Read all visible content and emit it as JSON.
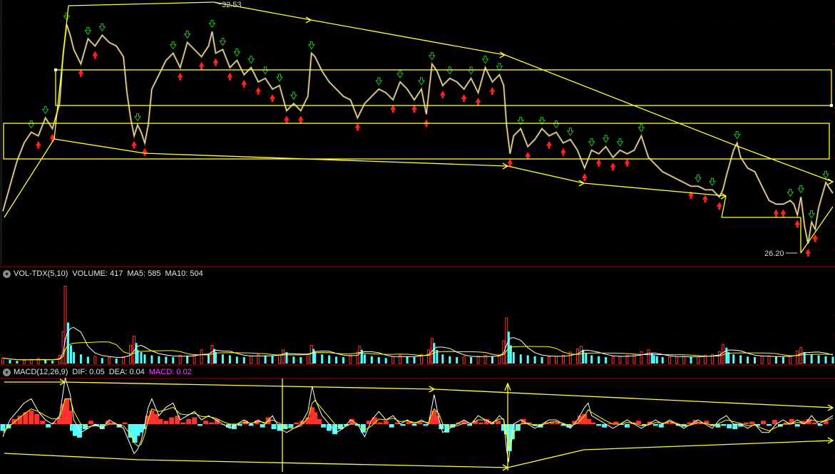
{
  "chart_data": {
    "type": "stock-chart",
    "price": {
      "type": "line",
      "high_label": "32.53",
      "low_label": "26.20",
      "ylim": [
        25.9,
        33.0
      ],
      "x": [
        0,
        10,
        20,
        30,
        40,
        50,
        60,
        70,
        80,
        85,
        90,
        95,
        100,
        110,
        120,
        130,
        140,
        150,
        160,
        170,
        175,
        180,
        185,
        190,
        195,
        200,
        205,
        210,
        220,
        230,
        240,
        250,
        260,
        270,
        280,
        290,
        295,
        300,
        310,
        320,
        330,
        340,
        350,
        360,
        370,
        380,
        390,
        400,
        410,
        420,
        430,
        435,
        440,
        450,
        460,
        470,
        480,
        490,
        500,
        505,
        510,
        520,
        530,
        540,
        550,
        560,
        570,
        580,
        590,
        597,
        605,
        612,
        620,
        630,
        640,
        650,
        660,
        670,
        680,
        690,
        700,
        706,
        710,
        715,
        720,
        730,
        740,
        750,
        760,
        770,
        780,
        790,
        800,
        810,
        820,
        830,
        840,
        850,
        860,
        870,
        880,
        890,
        900,
        910,
        920,
        930,
        940,
        950,
        960,
        970,
        980,
        990,
        1000,
        1010,
        1015,
        1020,
        1030,
        1035,
        1040,
        1050,
        1060,
        1070,
        1080,
        1090,
        1100,
        1110,
        1115,
        1120,
        1125,
        1130,
        1135,
        1140,
        1145,
        1150,
        1160,
        1170
      ],
      "y": [
        27.2,
        27.9,
        28.6,
        29.1,
        29.4,
        29.3,
        29.8,
        29.5,
        30.2,
        31.6,
        32.4,
        32.1,
        31.7,
        31.3,
        32.0,
        31.8,
        32.1,
        31.9,
        31.8,
        31.5,
        30.5,
        29.8,
        29.3,
        29.6,
        29.4,
        29.1,
        29.6,
        30.6,
        31.0,
        31.4,
        31.6,
        31.2,
        31.9,
        31.7,
        31.5,
        31.8,
        32.2,
        31.6,
        31.7,
        31.2,
        31.4,
        31.0,
        31.2,
        30.8,
        30.9,
        30.6,
        30.7,
        30.0,
        30.2,
        30.0,
        30.4,
        31.6,
        31.5,
        31.1,
        30.8,
        30.6,
        30.4,
        30.3,
        29.8,
        30.0,
        30.2,
        30.4,
        30.6,
        30.5,
        30.3,
        30.8,
        30.6,
        30.3,
        30.6,
        29.9,
        31.3,
        31.1,
        30.7,
        30.9,
        30.8,
        30.6,
        30.9,
        30.5,
        31.2,
        30.8,
        31.0,
        30.7,
        29.6,
        28.8,
        29.3,
        29.5,
        29.0,
        29.2,
        29.5,
        29.3,
        29.4,
        29.1,
        29.2,
        28.9,
        28.4,
        28.9,
        28.8,
        29.0,
        28.7,
        28.9,
        28.8,
        28.9,
        29.3,
        28.7,
        28.5,
        28.3,
        28.2,
        28.1,
        28.0,
        27.9,
        27.9,
        27.8,
        27.8,
        27.6,
        27.8,
        28.2,
        28.9,
        29.1,
        28.7,
        28.4,
        28.3,
        27.9,
        27.5,
        27.4,
        27.4,
        27.5,
        27.4,
        27.1,
        27.6,
        26.8,
        26.3,
        26.9,
        26.7,
        27.3,
        28.0,
        27.7,
        27.5,
        27.3
      ]
    },
    "volume": {
      "type": "bar",
      "title": "VOL-TDX(5,10)",
      "stats": [
        {
          "label": "VOLUME",
          "value": "417"
        },
        {
          "label": "MA5",
          "value": "585"
        },
        {
          "label": "MA10",
          "value": "504"
        }
      ],
      "x": [
        0,
        10,
        20,
        30,
        40,
        50,
        60,
        70,
        80,
        85,
        88,
        92,
        96,
        100,
        110,
        120,
        130,
        140,
        150,
        160,
        170,
        180,
        185,
        188,
        190,
        195,
        200,
        210,
        220,
        230,
        240,
        250,
        260,
        270,
        280,
        290,
        295,
        298,
        300,
        310,
        320,
        330,
        340,
        350,
        360,
        370,
        380,
        390,
        395,
        400,
        410,
        420,
        430,
        435,
        438,
        440,
        450,
        460,
        470,
        480,
        490,
        500,
        503,
        506,
        510,
        520,
        530,
        540,
        550,
        560,
        570,
        580,
        590,
        600,
        605,
        608,
        612,
        620,
        630,
        640,
        650,
        660,
        670,
        680,
        690,
        700,
        706,
        710,
        713,
        716,
        720,
        730,
        740,
        750,
        760,
        770,
        780,
        790,
        800,
        810,
        815,
        818,
        822,
        830,
        840,
        850,
        860,
        870,
        880,
        890,
        900,
        910,
        915,
        918,
        922,
        930,
        940,
        950,
        960,
        970,
        980,
        990,
        1000,
        1010,
        1015,
        1020,
        1023,
        1030,
        1040,
        1050,
        1060,
        1070,
        1080,
        1090,
        1100,
        1110,
        1120,
        1125,
        1130,
        1140,
        1150,
        1160,
        1170
      ],
      "values": [
        120,
        80,
        60,
        70,
        90,
        110,
        80,
        60,
        180,
        700,
        1700,
        900,
        400,
        250,
        200,
        150,
        160,
        120,
        130,
        110,
        150,
        400,
        600,
        450,
        300,
        250,
        200,
        180,
        160,
        150,
        140,
        180,
        170,
        200,
        300,
        200,
        400,
        320,
        250,
        200,
        180,
        150,
        140,
        160,
        200,
        180,
        170,
        200,
        300,
        250,
        150,
        140,
        200,
        400,
        320,
        250,
        200,
        180,
        150,
        140,
        180,
        250,
        380,
        300,
        200,
        160,
        140,
        120,
        150,
        180,
        160,
        140,
        200,
        300,
        550,
        450,
        300,
        200,
        160,
        140,
        150,
        140,
        160,
        180,
        150,
        200,
        500,
        1000,
        700,
        400,
        250,
        200,
        180,
        160,
        140,
        150,
        160,
        180,
        250,
        320,
        380,
        300,
        220,
        180,
        160,
        140,
        150,
        160,
        180,
        200,
        260,
        300,
        220,
        180,
        160,
        140,
        140,
        150,
        160,
        140,
        150,
        180,
        200,
        260,
        420,
        350,
        250,
        200,
        180,
        150,
        140,
        160,
        170,
        150,
        140,
        160,
        280,
        350,
        250,
        200,
        180,
        160,
        150
      ]
    },
    "macd": {
      "type": "line+bar",
      "title": "MACD(12,26,9)",
      "stats": [
        {
          "label": "DIF",
          "value": "0.05"
        },
        {
          "label": "DEA",
          "value": "0.04"
        },
        {
          "label": "MACD",
          "value": "0.02"
        }
      ],
      "ylim": [
        -0.55,
        0.55
      ],
      "x": [
        0,
        10,
        20,
        30,
        40,
        50,
        60,
        70,
        80,
        88,
        95,
        100,
        110,
        120,
        130,
        140,
        150,
        160,
        170,
        180,
        185,
        190,
        195,
        200,
        205,
        210,
        220,
        230,
        240,
        250,
        260,
        270,
        280,
        290,
        300,
        310,
        320,
        330,
        340,
        350,
        360,
        370,
        380,
        390,
        400,
        410,
        420,
        430,
        436,
        440,
        450,
        460,
        470,
        480,
        490,
        500,
        510,
        520,
        530,
        540,
        550,
        560,
        570,
        580,
        590,
        600,
        608,
        615,
        620,
        630,
        640,
        650,
        660,
        670,
        680,
        690,
        700,
        706,
        710,
        713,
        716,
        720,
        730,
        740,
        750,
        760,
        770,
        780,
        790,
        800,
        810,
        820,
        825,
        830,
        840,
        850,
        860,
        870,
        880,
        890,
        900,
        910,
        920,
        930,
        940,
        950,
        960,
        970,
        980,
        990,
        1000,
        1010,
        1020,
        1030,
        1040,
        1050,
        1060,
        1070,
        1080,
        1090,
        1100,
        1110,
        1120,
        1130,
        1140,
        1150,
        1160,
        1170
      ],
      "dif": [
        -0.15,
        0.05,
        0.15,
        0.25,
        0.3,
        0.15,
        0.05,
        0.0,
        0.1,
        0.55,
        0.35,
        0.05,
        -0.1,
        -0.05,
        0.0,
        -0.05,
        0.05,
        0.0,
        -0.05,
        -0.25,
        -0.35,
        -0.3,
        -0.2,
        0.0,
        0.2,
        0.3,
        0.1,
        0.2,
        0.25,
        0.05,
        0.1,
        0.15,
        0.05,
        0.1,
        0.05,
        0.0,
        -0.05,
        0.0,
        0.05,
        0.0,
        0.05,
        0.0,
        0.1,
        -0.05,
        -0.1,
        -0.05,
        0.0,
        0.15,
        0.45,
        0.3,
        0.1,
        0.0,
        -0.1,
        -0.05,
        0.05,
        0.0,
        -0.15,
        0.05,
        0.15,
        0.05,
        0.1,
        0.0,
        0.05,
        0.0,
        0.05,
        0.0,
        0.35,
        0.05,
        -0.1,
        -0.05,
        0.0,
        0.05,
        0.0,
        0.1,
        0.05,
        0.0,
        0.1,
        0.05,
        -0.3,
        -0.45,
        -0.2,
        0.0,
        0.05,
        0.0,
        -0.05,
        0.0,
        0.05,
        0.05,
        0.0,
        -0.05,
        0.05,
        0.2,
        0.25,
        0.1,
        0.05,
        0.0,
        -0.05,
        0.0,
        0.05,
        0.0,
        -0.05,
        0.0,
        0.05,
        0.0,
        0.05,
        0.0,
        -0.05,
        0.0,
        0.05,
        0.0,
        -0.05,
        0.05,
        0.1,
        0.0,
        0.0,
        -0.05,
        0.0,
        -0.1,
        -0.1,
        0.0,
        0.05,
        0.0,
        0.05,
        0.0,
        0.1,
        0.0,
        0.05,
        0.1
      ],
      "dea": [
        -0.1,
        -0.02,
        0.05,
        0.12,
        0.18,
        0.15,
        0.1,
        0.06,
        0.07,
        0.3,
        0.3,
        0.15,
        0.0,
        -0.03,
        -0.02,
        -0.03,
        0.0,
        0.0,
        -0.02,
        -0.12,
        -0.22,
        -0.26,
        -0.24,
        -0.12,
        0.05,
        0.18,
        0.15,
        0.17,
        0.2,
        0.12,
        0.11,
        0.13,
        0.09,
        0.09,
        0.07,
        0.03,
        0.0,
        0.0,
        0.02,
        0.01,
        0.03,
        0.02,
        0.05,
        0.01,
        -0.04,
        -0.05,
        -0.02,
        0.07,
        0.25,
        0.28,
        0.18,
        0.08,
        -0.02,
        -0.04,
        0.0,
        0.0,
        -0.07,
        -0.02,
        0.06,
        0.05,
        0.07,
        0.03,
        0.04,
        0.02,
        0.03,
        0.02,
        0.18,
        0.12,
        0.0,
        -0.03,
        -0.02,
        0.01,
        0.01,
        0.05,
        0.05,
        0.02,
        0.06,
        0.06,
        -0.12,
        -0.28,
        -0.25,
        -0.1,
        0.0,
        0.01,
        -0.02,
        -0.01,
        0.02,
        0.03,
        0.01,
        -0.02,
        0.01,
        0.1,
        0.17,
        0.14,
        0.09,
        0.04,
        0.0,
        0.0,
        0.02,
        0.01,
        -0.02,
        -0.01,
        0.02,
        0.01,
        0.03,
        0.01,
        -0.02,
        -0.01,
        0.02,
        0.01,
        -0.02,
        0.01,
        0.05,
        0.03,
        0.01,
        -0.02,
        -0.01,
        -0.05,
        -0.08,
        -0.04,
        0.0,
        0.0,
        0.02,
        0.01,
        0.05,
        0.03,
        0.04,
        0.07
      ],
      "hist_x": [
        0,
        8,
        16,
        24,
        32,
        40,
        48,
        56,
        64,
        72,
        80,
        86,
        90,
        94,
        98,
        102,
        108,
        116,
        124,
        132,
        140,
        148,
        156,
        164,
        172,
        180,
        186,
        190,
        194,
        198,
        204,
        210,
        216,
        222,
        230,
        238,
        246,
        254,
        262,
        270,
        278,
        286,
        294,
        302,
        310,
        318,
        326,
        334,
        342,
        350,
        358,
        366,
        374,
        382,
        390,
        398,
        406,
        414,
        422,
        430,
        436,
        440,
        446,
        452,
        460,
        468,
        476,
        484,
        492,
        500,
        508,
        516,
        524,
        532,
        540,
        548,
        556,
        564,
        572,
        580,
        588,
        596,
        604,
        608,
        612,
        618,
        626,
        634,
        642,
        650,
        658,
        666,
        674,
        682,
        690,
        698,
        706,
        710,
        714,
        718,
        726,
        734,
        742,
        750,
        758,
        766,
        774,
        782,
        790,
        798,
        806,
        814,
        820,
        826,
        832,
        840,
        848,
        856,
        864,
        872,
        880,
        888,
        896,
        904,
        912,
        920,
        928,
        936,
        944,
        952,
        960,
        968,
        976,
        984,
        992,
        1000,
        1008,
        1016,
        1024,
        1032,
        1040,
        1048,
        1056,
        1064,
        1072,
        1080,
        1088,
        1096,
        1104,
        1112,
        1120,
        1128,
        1136,
        1144,
        1152,
        1160,
        1168
      ],
      "hist": [
        -0.08,
        -0.05,
        0.06,
        0.1,
        0.14,
        0.16,
        0.12,
        0.04,
        -0.04,
        0.02,
        0.08,
        0.24,
        0.3,
        0.16,
        -0.08,
        -0.14,
        -0.16,
        -0.06,
        0.04,
        -0.02,
        -0.06,
        0.04,
        0.02,
        -0.04,
        0.02,
        -0.16,
        -0.22,
        -0.14,
        -0.1,
        -0.06,
        0.1,
        0.16,
        0.12,
        0.06,
        0.04,
        0.08,
        0.1,
        0.02,
        0.06,
        0.08,
        -0.02,
        0.04,
        0.02,
        0.06,
        0.0,
        -0.04,
        -0.06,
        -0.02,
        0.04,
        -0.02,
        0.04,
        -0.04,
        0.08,
        -0.06,
        -0.08,
        -0.06,
        -0.04,
        0.02,
        0.04,
        0.08,
        0.2,
        0.14,
        0.06,
        -0.04,
        -0.08,
        -0.12,
        -0.06,
        -0.02,
        0.06,
        -0.02,
        -0.1,
        0.04,
        0.08,
        0.02,
        0.04,
        -0.04,
        0.02,
        -0.02,
        0.03,
        -0.02,
        0.02,
        -0.02,
        0.08,
        0.16,
        0.1,
        -0.06,
        -0.1,
        -0.04,
        0.02,
        0.04,
        -0.02,
        0.04,
        0.02,
        0.06,
        0.02,
        0.04,
        -0.08,
        -0.12,
        -0.32,
        -0.18,
        -0.08,
        0.06,
        0.02,
        -0.02,
        -0.04,
        0.02,
        0.03,
        0.02,
        -0.02,
        -0.04,
        0.04,
        0.1,
        0.12,
        0.06,
        0.02,
        -0.02,
        -0.04,
        0.01,
        0.03,
        -0.01,
        -0.04,
        0.02,
        0.04,
        -0.02,
        0.03,
        -0.02,
        -0.04,
        0.02,
        0.03,
        -0.02,
        -0.03,
        0.02,
        0.05,
        0.02,
        0.04,
        -0.02,
        -0.04,
        -0.02,
        -0.05,
        -0.06,
        -0.03,
        0.02,
        0.03,
        -0.02,
        0.04,
        -0.02,
        0.05,
        -0.03,
        0.02,
        0.06,
        -0.03,
        0.04,
        0.06,
        0.02,
        -0.02,
        0.04
      ]
    },
    "colors": {
      "background": "#000000",
      "grid": "#3a0000",
      "separator": "#b00000",
      "price_line": "#e8e8e8",
      "trendline": "#ffff33",
      "up": "#ff3232",
      "down": "#54ffff",
      "dif": "#ffffff",
      "dea": "#ffff00",
      "macd_label": "#ff40ff",
      "buy_marker": "#ff2020",
      "sell_marker": "#20c020"
    }
  }
}
